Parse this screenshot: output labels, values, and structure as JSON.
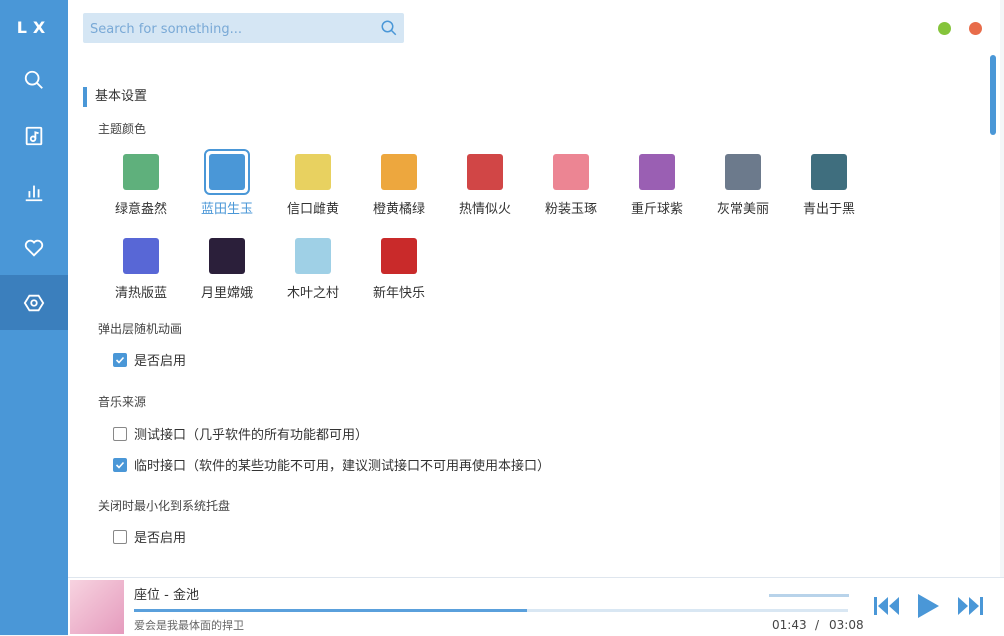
{
  "app": {
    "logo": "LX"
  },
  "sidebar": {
    "items": [
      {
        "name": "search",
        "icon": "search-icon"
      },
      {
        "name": "music-library",
        "icon": "music-note-icon"
      },
      {
        "name": "leaderboard",
        "icon": "bar-chart-icon"
      },
      {
        "name": "favorites",
        "icon": "heart-icon"
      },
      {
        "name": "settings",
        "icon": "settings-icon",
        "active": true
      }
    ]
  },
  "search": {
    "placeholder": "Search for something..."
  },
  "window": {
    "minimize_color": "#85c43b",
    "close_color": "#e86c4a"
  },
  "settings": {
    "section_title": "基本设置",
    "theme_title": "主题颜色",
    "themes": [
      {
        "label": "绿意盎然",
        "color": "#5fb07c"
      },
      {
        "label": "蓝田生玉",
        "color": "#4a97d7",
        "selected": true
      },
      {
        "label": "信口雌黄",
        "color": "#e8d160"
      },
      {
        "label": "橙黄橘绿",
        "color": "#eda73e"
      },
      {
        "label": "热情似火",
        "color": "#d14646"
      },
      {
        "label": "粉装玉琢",
        "color": "#ec8593"
      },
      {
        "label": "重斤球紫",
        "color": "#9a5fb3"
      },
      {
        "label": "灰常美丽",
        "color": "#6c7a8c"
      },
      {
        "label": "青出于黑",
        "color": "#3f6e7e"
      },
      {
        "label": "清热版蓝",
        "color": "#5867d6"
      },
      {
        "label": "月里嫦娥",
        "color": "#2b1f3a"
      },
      {
        "label": "木叶之村",
        "color": "#9fd0e6"
      },
      {
        "label": "新年快乐",
        "color": "#c92a2a"
      }
    ],
    "popup_title": "弹出层随机动画",
    "popup_enable": "是否启用",
    "source_title": "音乐来源",
    "source_test": "测试接口（几乎软件的所有功能都可用）",
    "source_temp": "临时接口（软件的某些功能不可用，建议测试接口不可用再使用本接口）",
    "tray_title": "关闭时最小化到系统托盘",
    "tray_enable": "是否启用"
  },
  "player": {
    "song": "座位 - 金池",
    "lyric": "爱会是我最体面的捍卫",
    "current_time": "01:43",
    "separator": "/",
    "total_time": "03:08",
    "progress": 0.55,
    "accent": "#4a97d7"
  }
}
